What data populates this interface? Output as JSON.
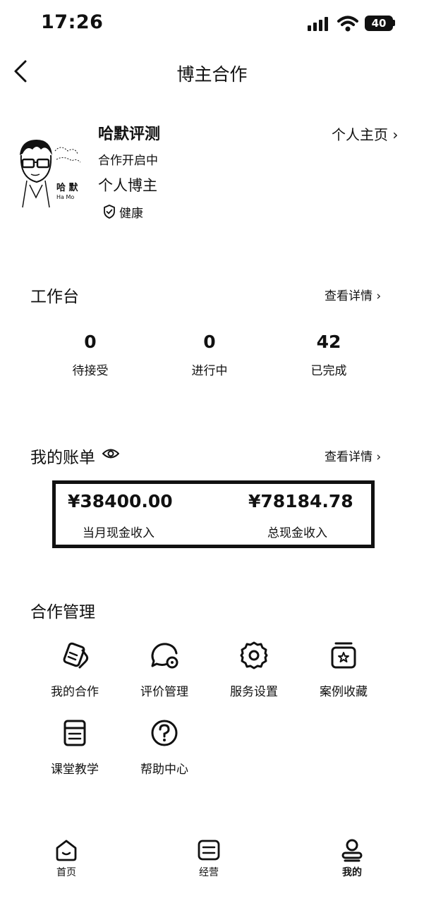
{
  "status_bar": {
    "time": "17:26",
    "battery": "40"
  },
  "nav": {
    "title": "博主合作"
  },
  "profile": {
    "name": "哈默评测",
    "status": "合作开启中",
    "type": "个人博主",
    "health": "健康",
    "homepage_link": "个人主页 ›",
    "avatar_caption": "哈 默",
    "avatar_sub": "Ha  Mo"
  },
  "workbench": {
    "title": "工作台",
    "detail": "查看详情 ›",
    "stats": [
      {
        "value": "0",
        "label": "待接受"
      },
      {
        "value": "0",
        "label": "进行中"
      },
      {
        "value": "42",
        "label": "已完成"
      }
    ]
  },
  "bill": {
    "title": "我的账单",
    "detail": "查看详情 ›",
    "monthly_amount": "¥38400.00",
    "monthly_label": "当月现金收入",
    "total_amount": "¥78184.78",
    "total_label": "总现金收入"
  },
  "management": {
    "title": "合作管理",
    "items": [
      {
        "label": "我的合作",
        "icon": "cooperation-icon"
      },
      {
        "label": "评价管理",
        "icon": "comment-icon"
      },
      {
        "label": "服务设置",
        "icon": "gear-icon"
      },
      {
        "label": "案例收藏",
        "icon": "star-box-icon"
      },
      {
        "label": "课堂教学",
        "icon": "book-icon"
      },
      {
        "label": "帮助中心",
        "icon": "help-icon"
      }
    ]
  },
  "tab_bar": {
    "items": [
      {
        "label": "首页",
        "icon": "home-icon"
      },
      {
        "label": "经营",
        "icon": "business-icon"
      },
      {
        "label": "我的",
        "icon": "user-icon"
      }
    ]
  }
}
